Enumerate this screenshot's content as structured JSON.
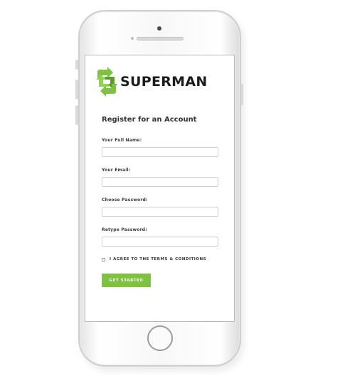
{
  "brand": {
    "name": "SUPERMAN",
    "logo_icon": "recycle-arrows-icon",
    "accent_color": "#7fc241"
  },
  "form": {
    "title": "Register for an Account",
    "fields": [
      {
        "label": "Your Full Name:",
        "value": "",
        "placeholder": ""
      },
      {
        "label": "Your Email:",
        "value": "",
        "placeholder": ""
      },
      {
        "label": "Choose Password:",
        "value": "",
        "placeholder": ""
      },
      {
        "label": "Retype Password:",
        "value": "",
        "placeholder": ""
      }
    ],
    "agree_label": "I AGREE TO THE TERMS & CONDITIONS",
    "agree_checked": false,
    "submit_label": "GET STARTED"
  }
}
